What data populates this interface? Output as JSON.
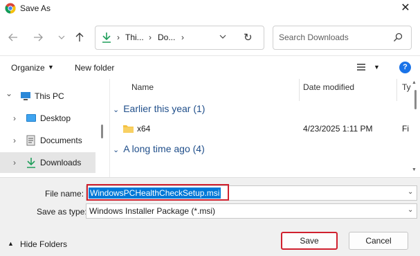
{
  "window": {
    "title": "Save As",
    "close_glyph": "✕",
    "icon": "chrome-icon"
  },
  "nav": {
    "back_icon": "back-arrow-icon",
    "forward_icon": "forward-arrow-icon",
    "history_icon": "chevron-down-icon",
    "up_icon": "up-arrow-icon"
  },
  "address": {
    "icon": "download-icon",
    "sep": "›",
    "crumbs": [
      "Thi...",
      "Do..."
    ],
    "dropdown_icon": "chevron-down-icon",
    "refresh_glyph": "↻"
  },
  "search": {
    "placeholder": "Search Downloads",
    "icon": "search-icon"
  },
  "toolbar": {
    "organize": "Organize",
    "caret": "▼",
    "new_folder": "New folder",
    "help": "?"
  },
  "sidebar": {
    "items": [
      {
        "label": "This PC",
        "icon": "pc-icon",
        "chevron": "⌄"
      },
      {
        "label": "Desktop",
        "icon": "desktop-icon",
        "chevron": "›"
      },
      {
        "label": "Documents",
        "icon": "documents-icon",
        "chevron": "›"
      },
      {
        "label": "Downloads",
        "icon": "download-icon",
        "chevron": "›",
        "selected": true
      }
    ]
  },
  "columns": {
    "name": "Name",
    "date": "Date modified",
    "type": "Ty"
  },
  "groups": [
    {
      "label": "Earlier this year (1)",
      "chevron": "⌄"
    },
    {
      "label": "A long time ago (4)",
      "chevron": "⌄"
    }
  ],
  "files": [
    {
      "name": "x64",
      "date": "4/23/2025 1:11 PM",
      "type": "Fi",
      "icon": "folder-icon"
    }
  ],
  "form": {
    "file_name_label": "File name:",
    "file_name_value": "WindowsPCHealthCheckSetup.msi",
    "save_as_type_label": "Save as type:",
    "save_as_type_value": "Windows Installer Package (*.msi)",
    "dropdown_glyph": "⌄"
  },
  "footer": {
    "hide_folders": "Hide Folders",
    "caret": "▲",
    "save": "Save",
    "cancel": "Cancel"
  },
  "colors": {
    "highlight_border": "#d0202e",
    "selection": "#0078d7",
    "group_text": "#1f4e8a",
    "download_green": "#1e9e5a",
    "folder_yellow": "#f5c242"
  }
}
